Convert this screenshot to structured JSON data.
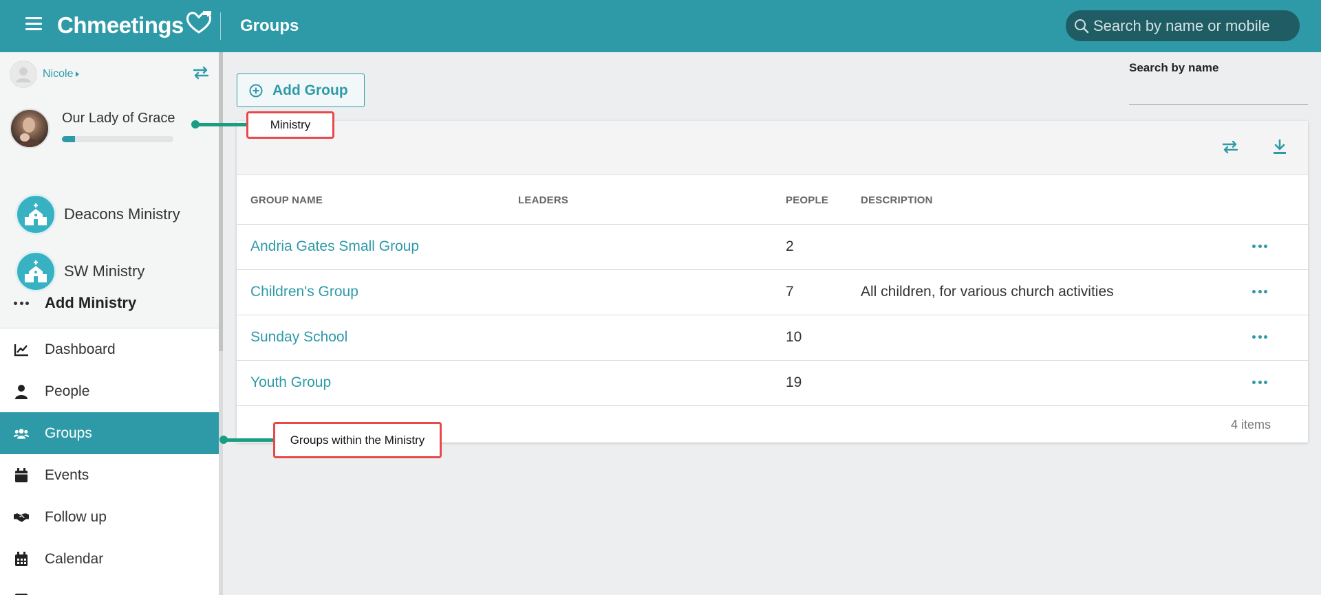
{
  "header": {
    "app_name": "Chmeetings",
    "page_title": "Groups",
    "search_placeholder": "Search by name or mobile"
  },
  "sidebar": {
    "user_name": "Nicole",
    "church": {
      "name": "Our Lady of Grace",
      "progress_fraction": 0.12
    },
    "ministries": [
      {
        "label": "Deacons Ministry",
        "icon": "church-icon"
      },
      {
        "label": "SW Ministry",
        "icon": "church-icon"
      }
    ],
    "add_ministry_label": "Add Ministry",
    "nav": [
      {
        "label": "Dashboard",
        "icon": "chart-line-icon",
        "active": false
      },
      {
        "label": "People",
        "icon": "person-icon",
        "active": false
      },
      {
        "label": "Groups",
        "icon": "users-icon",
        "active": true
      },
      {
        "label": "Events",
        "icon": "calendar-icon",
        "active": false
      },
      {
        "label": "Follow up",
        "icon": "handshake-icon",
        "active": false
      },
      {
        "label": "Calendar",
        "icon": "calendar-grid-icon",
        "active": false
      }
    ]
  },
  "main": {
    "add_group_label": "Add Group",
    "search_by_name_label": "Search by name",
    "search_by_name_value": "",
    "table": {
      "columns": [
        "GROUP NAME",
        "LEADERS",
        "PEOPLE",
        "DESCRIPTION"
      ],
      "rows": [
        {
          "name": "Andria Gates Small Group",
          "leaders": "",
          "people": "2",
          "description": ""
        },
        {
          "name": "Children's Group",
          "leaders": "",
          "people": "7",
          "description": "All children, for various church activities"
        },
        {
          "name": "Sunday School",
          "leaders": "",
          "people": "10",
          "description": ""
        },
        {
          "name": "Youth Group",
          "leaders": "",
          "people": "19",
          "description": ""
        }
      ],
      "footer": "4 items"
    }
  },
  "annotations": {
    "ministry": "Ministry",
    "groups": "Groups within the Ministry"
  },
  "colors": {
    "brand": "#2e9aa8",
    "annotation_line": "#1a9e82",
    "annotation_border": "#e8484a"
  }
}
